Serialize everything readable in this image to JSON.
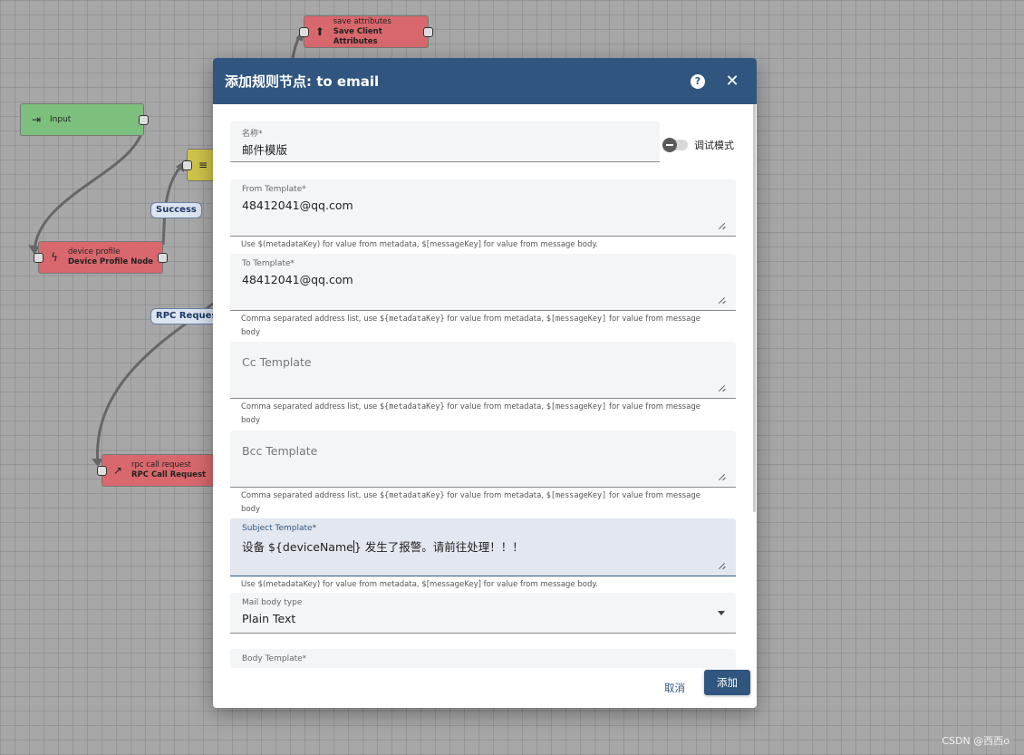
{
  "canvas": {
    "nodes": {
      "input": {
        "icon": "input-icon",
        "name": "Input"
      },
      "save_attributes": {
        "type": "save attributes",
        "name": "Save Client Attributes",
        "icon": "upload-icon"
      },
      "device_profile": {
        "type": "device profile",
        "name": "Device Profile Node",
        "icon": "bolt-icon"
      },
      "filter": {
        "icon": "filter-icon"
      },
      "rpc_call": {
        "type": "rpc call request",
        "name": "RPC Call Request",
        "icon": "arrow-up-right-icon"
      }
    },
    "edge_labels": {
      "success": "Success",
      "rpc": "RPC Request"
    }
  },
  "dialog": {
    "title": "添加规则节点: to email",
    "name_field": {
      "label": "名称*",
      "value": "邮件模版"
    },
    "debug_toggle": {
      "label": "调试模式",
      "on": false
    },
    "from_template": {
      "label": "From Template*",
      "value": "48412041@qq.com"
    },
    "hint_single": "Use $(metadataKey) for value from metadata, $[messageKey] for value from message body.",
    "to_template": {
      "label": "To Template*",
      "value": "48412041@qq.com"
    },
    "hint_list": {
      "prefix": "Comma separated address list, use ",
      "meta": "${metadataKey}",
      "middle": " for value from metadata, ",
      "msg": "$[messageKey]",
      "suffix": " for value from message body"
    },
    "cc_template": {
      "placeholder": "Cc Template"
    },
    "bcc_template": {
      "placeholder": "Bcc Template"
    },
    "subject_template": {
      "label": "Subject Template*",
      "value_before_caret": "设备 ${deviceName",
      "value_after_caret": "} 发生了报警。请前往处理！！！"
    },
    "mail_body_type": {
      "label": "Mail body type",
      "value": "Plain Text"
    },
    "body_template": {
      "label": "Body Template*"
    },
    "cancel_label": "取消",
    "add_label": "添加"
  },
  "watermark": "CSDN @西西o",
  "colors": {
    "header": "#305680",
    "node_red": "#d8686d",
    "node_green": "#7dc07d",
    "node_yellow": "#cfc34a"
  }
}
